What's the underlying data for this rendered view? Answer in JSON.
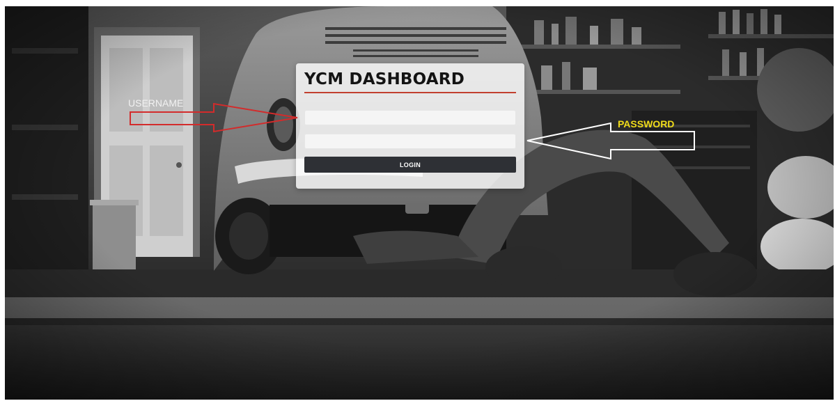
{
  "login_panel": {
    "title": "YCM DASHBOARD",
    "username_value": "",
    "password_value": "",
    "login_label": "LOGIN"
  },
  "annotations": {
    "username_label": "USERNAME",
    "password_label": "PASSWORD"
  },
  "colors": {
    "title_rule": "#c2402f",
    "login_button": "#2e3035",
    "username_arrow": "#d32b2b",
    "password_arrow": "#ffffff",
    "password_label": "#f0dc1a"
  },
  "icons": {
    "username_pointer": "arrow-right-icon",
    "password_pointer": "arrow-left-icon"
  }
}
